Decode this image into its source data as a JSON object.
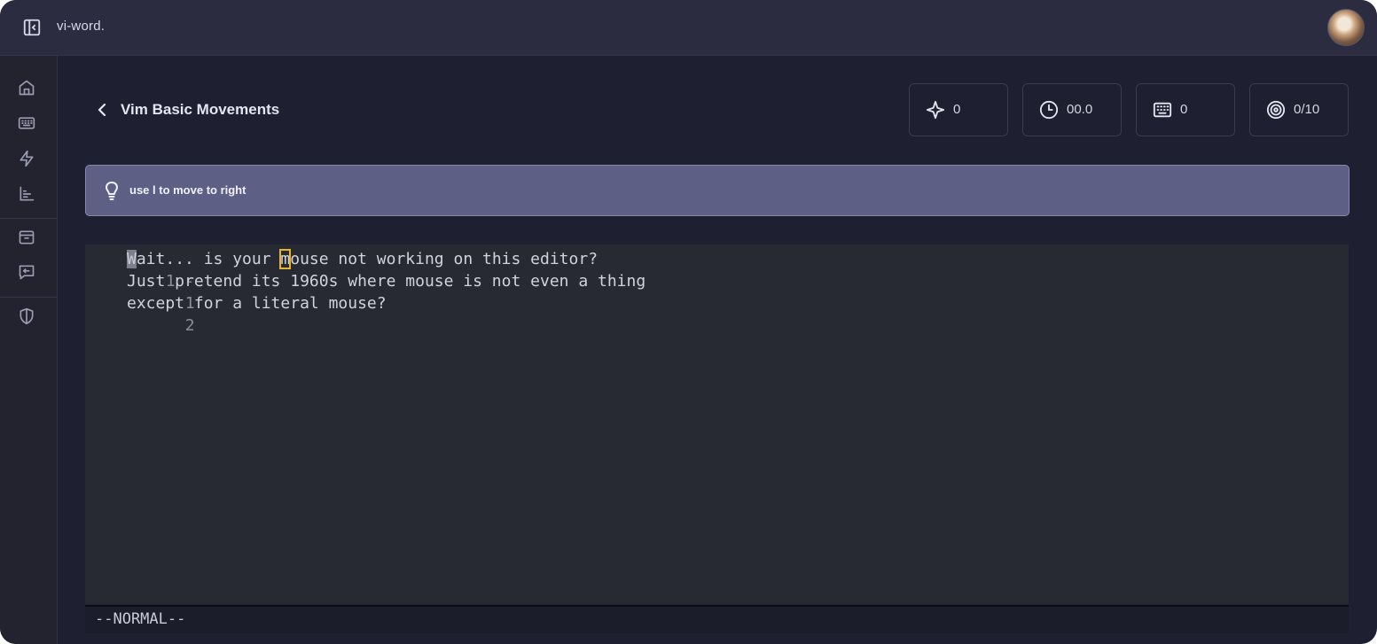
{
  "app": {
    "title": "vi-word."
  },
  "sidebar": {
    "items": [
      {
        "icon": "home-icon"
      },
      {
        "icon": "keyboard-icon"
      },
      {
        "icon": "zap-icon"
      },
      {
        "icon": "bar-chart-icon"
      },
      {
        "icon": "inbox-icon"
      },
      {
        "icon": "feedback-icon"
      },
      {
        "icon": "shield-icon"
      }
    ]
  },
  "lesson": {
    "title": "Vim Basic Movements"
  },
  "stats": [
    {
      "icon": "sparkle-icon",
      "value": "0"
    },
    {
      "icon": "clock-icon",
      "value": "00.0"
    },
    {
      "icon": "keyboard-icon",
      "value": "0"
    },
    {
      "icon": "target-icon",
      "value": "0/10"
    }
  ],
  "hint": {
    "icon": "lightbulb-icon",
    "text": "use l to move to right"
  },
  "editor": {
    "lines": [
      {
        "number": "1 -",
        "first_char": "W",
        "before_target": "ait... is your ",
        "target_char": "m",
        "after_target": "ouse not working on this editor?"
      },
      {
        "number": "1",
        "text": "Just pretend its 1960s where mouse is not even a thing"
      },
      {
        "number": "2",
        "text": "except for a literal mouse?"
      }
    ],
    "mode": "--NORMAL--"
  },
  "colors": {
    "background": "#1e1f30",
    "hint_bg": "#5d5f84",
    "editor_bg": "#272a33",
    "target_outline": "#e8b526"
  }
}
